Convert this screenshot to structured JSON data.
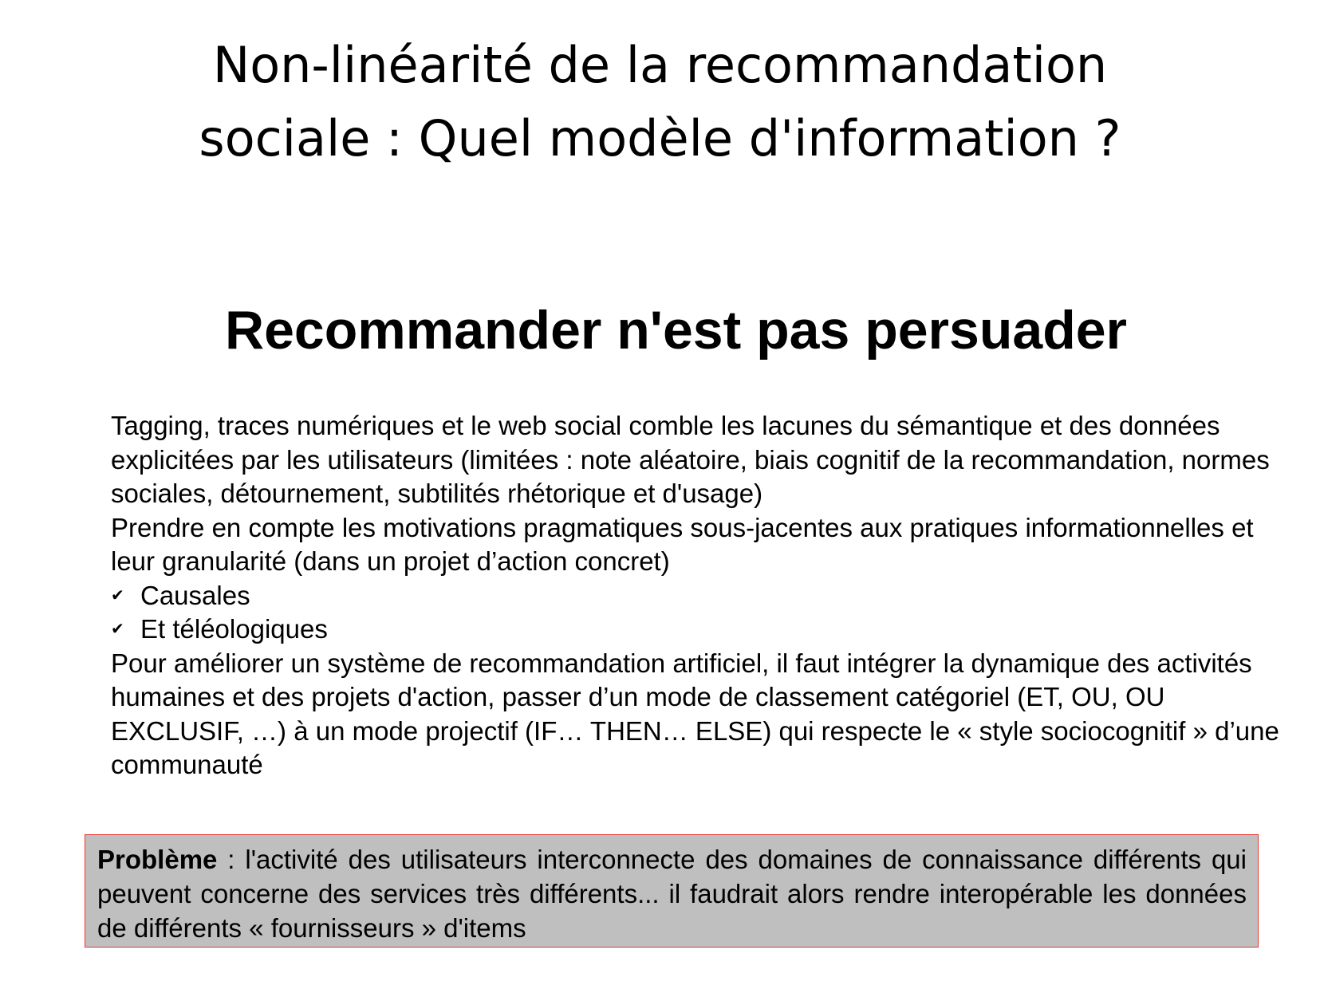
{
  "title": {
    "line1": "Non-linéarité de la recommandation",
    "line2": "sociale : Quel modèle d'information ?"
  },
  "subtitle": "Recommander n'est pas persuader",
  "body": {
    "paragraph1": "Tagging, traces numériques et le web social comble les lacunes du sémantique et des données explicitées par les utilisateurs (limitées : note aléatoire, biais cognitif de la recommandation, normes sociales, détournement, subtilités rhétorique et d'usage)",
    "paragraph2": "Prendre en compte les motivations pragmatiques sous-jacentes aux pratiques informationnelles et leur granularité (dans un projet d’action concret)",
    "bullets": [
      {
        "icon": "check-icon",
        "text": "Causales"
      },
      {
        "icon": "check-icon",
        "text": "Et téléologiques"
      }
    ],
    "paragraph3": "Pour améliorer un système de recommandation artificiel, il faut intégrer la dynamique des activités humaines et des projets d'action, passer d’un mode de classement catégoriel (ET, OU, OU EXCLUSIF, …) à un mode projectif (IF… THEN… ELSE) qui respecte le « style sociocognitif » d’une communauté"
  },
  "problem": {
    "label": "Problème",
    "text": " : l'activité des utilisateurs interconnecte des domaines de connaissance différents qui peuvent concerne des services très différents... il faudrait alors rendre interopérable les données de différents « fournisseurs » d'items",
    "background_color": "#bfbfbf",
    "border_color": "#e8362f"
  }
}
